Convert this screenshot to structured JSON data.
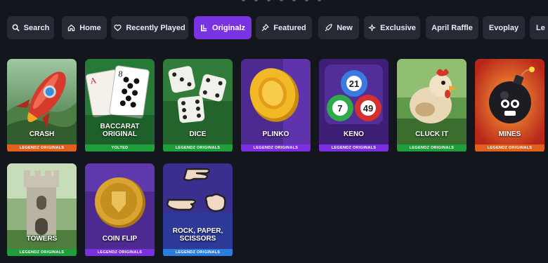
{
  "nav": {
    "items": [
      {
        "label": "Search",
        "icon": "search-icon",
        "active": false
      },
      {
        "label": "Home",
        "icon": "home-icon",
        "active": false
      },
      {
        "label": "Recently Played",
        "icon": "heart-icon",
        "active": false
      },
      {
        "label": "Originalz",
        "icon": "originalz-icon",
        "active": true
      },
      {
        "label": "Featured",
        "icon": "pin-icon",
        "active": false
      },
      {
        "label": "New",
        "icon": "rocket-icon",
        "active": false
      },
      {
        "label": "Exclusive",
        "icon": "sparkle-icon",
        "active": false
      },
      {
        "label": "April Raffle",
        "icon": "",
        "active": false
      },
      {
        "label": "Evoplay",
        "icon": "",
        "active": false
      },
      {
        "label": "Le",
        "icon": "",
        "active": false
      }
    ]
  },
  "games": [
    {
      "title": "CRASH",
      "tag": "LEGENDZ ORIGINALS",
      "art": "rocket",
      "strip_color": "#e0601c"
    },
    {
      "title": "BACCARAT ORIGINAL",
      "tag": "YOLTED",
      "art": "cards",
      "strip_color": "#1f9e3c"
    },
    {
      "title": "DICE",
      "tag": "LEGENDZ ORIGINALS",
      "art": "dice",
      "strip_color": "#1f9e3c"
    },
    {
      "title": "PLINKO",
      "tag": "LEGENDZ ORIGINALS",
      "art": "coin-gold",
      "strip_color": "#7b2fe0"
    },
    {
      "title": "KENO",
      "tag": "LEGENDZ ORIGINALS",
      "art": "keno-balls",
      "strip_color": "#7b2fe0"
    },
    {
      "title": "CLUCK IT",
      "tag": "LEGENDZ ORIGINALS",
      "art": "chicken",
      "strip_color": "#1f9e3c"
    },
    {
      "title": "MINES",
      "tag": "LEGENDZ ORIGINALS",
      "art": "bomb",
      "strip_color": "#e0601c"
    },
    {
      "title": "TOWERS",
      "tag": "LEGENDZ ORIGINALS",
      "art": "tower",
      "strip_color": "#1f9e3c"
    },
    {
      "title": "COIN FLIP",
      "tag": "LEGENDZ ORIGINALS",
      "art": "coin-flip",
      "strip_color": "#7b2fe0"
    },
    {
      "title": "ROCK, PAPER, SCISSORS",
      "tag": "LEGENDZ ORIGINALS",
      "art": "hands",
      "strip_color": "#2b7ee0"
    }
  ],
  "keno_numbers": [
    "21",
    "7",
    "49"
  ],
  "baccarat_cards": [
    "A",
    "8"
  ]
}
